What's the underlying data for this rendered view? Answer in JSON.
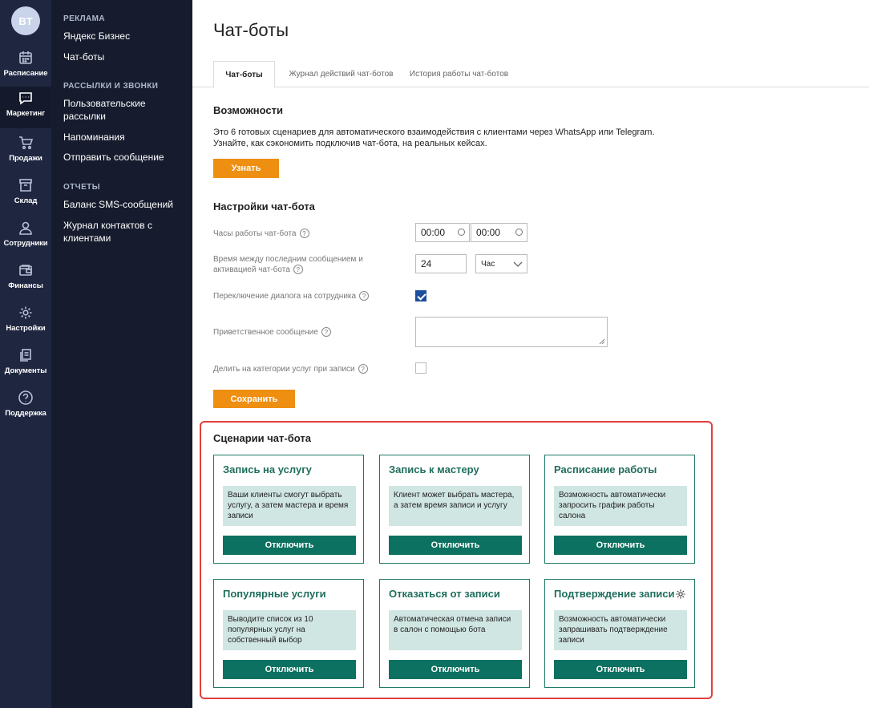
{
  "user": {
    "initials": "BT"
  },
  "rail": [
    {
      "label": "Расписание",
      "icon": "calendar-icon"
    },
    {
      "label": "Маркетинг",
      "icon": "chat-icon"
    },
    {
      "label": "Продажи",
      "icon": "cart-icon"
    },
    {
      "label": "Склад",
      "icon": "archive-icon"
    },
    {
      "label": "Сотрудники",
      "icon": "user-icon"
    },
    {
      "label": "Финансы",
      "icon": "wallet-icon"
    },
    {
      "label": "Настройки",
      "icon": "gear-icon"
    },
    {
      "label": "Документы",
      "icon": "documents-icon"
    },
    {
      "label": "Поддержка",
      "icon": "help-icon"
    }
  ],
  "subnav": {
    "groups": [
      {
        "title": "РЕКЛАМА",
        "items": [
          "Яндекс Бизнес",
          "Чат-боты"
        ]
      },
      {
        "title": "РАССЫЛКИ И ЗВОНКИ",
        "items": [
          "Пользовательские рассылки",
          "Напоминания",
          "Отправить сообщение"
        ]
      },
      {
        "title": "ОТЧЕТЫ",
        "items": [
          "Баланс SMS-сообщений",
          "Журнал контактов с клиентами"
        ]
      }
    ]
  },
  "page": {
    "title": "Чат-боты"
  },
  "tabs": [
    "Чат-боты",
    "Журнал действий чат-ботов",
    "История работы чат-ботов"
  ],
  "features": {
    "title": "Возможности",
    "line1": "Это 6 готовых сценариев для автоматического взаимодействия с клиентами через WhatsApp или Telegram.",
    "line2": "Узнайте, как сэкономить подключив чат-бота, на реальных кейсах.",
    "button": "Узнать"
  },
  "settings": {
    "title": "Настройки чат-бота",
    "hours_label": "Часы работы чат-бота",
    "hours_from": "00:00",
    "hours_to": "00:00",
    "delay_label_1": "Время между последним сообщением и",
    "delay_label_2": "активацией чат-бота",
    "delay_value": "24",
    "delay_unit": "Час",
    "switch_label": "Переключение диалога на сотрудника",
    "switch_checked": true,
    "greeting_label": "Приветственное сообщение",
    "greeting_value": "",
    "categories_label": "Делить на категории услуг при записи",
    "categories_checked": false,
    "save_button": "Сохранить",
    "help_glyph": "?"
  },
  "scenarios": {
    "title": "Сценарии чат-бота",
    "cards": [
      {
        "title": "Запись на услугу",
        "desc": "Ваши клиенты смогут выбрать услугу, а затем мастера и время записи",
        "button": "Отключить"
      },
      {
        "title": "Запись к мастеру",
        "desc": "Клиент может выбрать мастера, а затем время записи и услугу",
        "button": "Отключить"
      },
      {
        "title": "Расписание работы",
        "desc": "Возможность автоматически запросить график работы салона",
        "button": "Отключить"
      },
      {
        "title": "Популярные услуги",
        "desc": "Выводите список из 10 популярных услуг на собственный выбор",
        "button": "Отключить"
      },
      {
        "title": "Отказаться от записи",
        "desc": "Автоматическая отмена записи в салон с помощью бота",
        "button": "Отключить"
      },
      {
        "title": "Подтверждение записи",
        "desc": "Возможность автоматически запрашивать подтверждение записи",
        "button": "Отключить",
        "has_settings": true
      }
    ]
  },
  "colors": {
    "rail_bg": "#1f2740",
    "subnav_bg": "#161c2e",
    "accent_orange": "#ee8f12",
    "card_green": "#0d7161",
    "highlight_red": "#e0403c"
  }
}
